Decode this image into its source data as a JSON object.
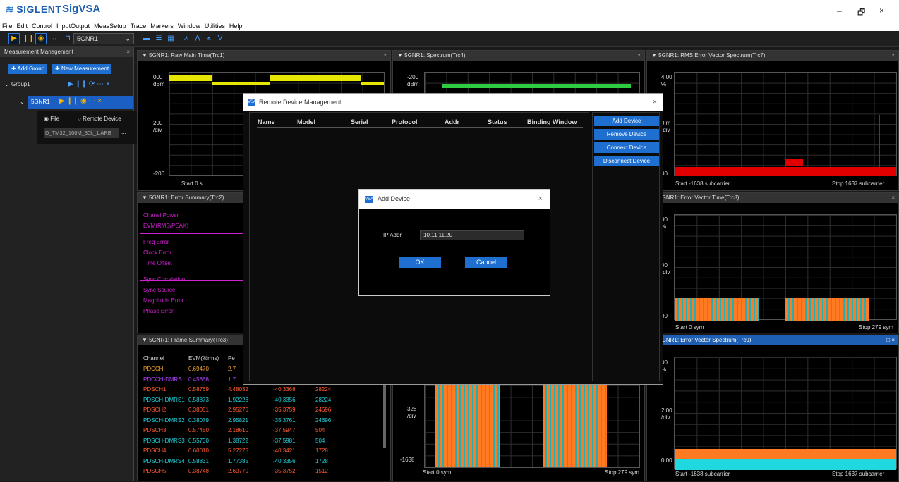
{
  "titlebar": {
    "brand": "SIGLENT",
    "app": "SigVSA",
    "min": "–",
    "max": "🗗",
    "close": "×"
  },
  "menu": [
    "File",
    "Edit",
    "Control",
    "InputOutput",
    "MeasSetup",
    "Trace",
    "Markers",
    "Window",
    "Utilities",
    "Help"
  ],
  "toolbar": {
    "meas_select": "5GNR1"
  },
  "mm": {
    "title": "Measurement Management",
    "add_group": "Add Group",
    "new_meas": "New Measurement",
    "group": "Group1",
    "meas": "5GNR1",
    "file_label": "File",
    "remote_label": "Remote Device",
    "file_path": "D_TM32_100M_30k_1.ARB",
    "dots": "..."
  },
  "panels": {
    "raw": {
      "title": "5GNR1: Raw Main Time(Trc1)",
      "top": "000",
      "unit": "dBm",
      "div": "200",
      "div_unit": "/div",
      "bottom": "-200",
      "start": "Start 0 s"
    },
    "spec": {
      "title": "5GNR1: Spectrum(Trc4)",
      "top": "-200",
      "unit": "dBm"
    },
    "rms": {
      "title": "5GNR1: RMS Error Vector Spectrum(Trc7)",
      "top": "4.00",
      "unit": "%",
      "mid": "0 m",
      "div": "/div",
      "bottom": "00",
      "start": "Start -1638 subcarrier",
      "stop": "Stop 1637 subcarrier"
    },
    "err": {
      "title": "5GNR1: Error Summary(Trc2)",
      "rows": [
        "Chanel Power",
        "EVM(RMS/PEAK)",
        "Freq Error",
        "Clock Error",
        "Time Offset",
        "Sync Correlation",
        "Sync Source",
        "Magnitude Error",
        "Phase Error"
      ]
    },
    "evt": {
      "title": "5GNR1: Error Vector Time(Trc8)",
      "top": "00",
      "unit": "%",
      "mid": "00",
      "div": "/div",
      "bottom": "00",
      "start": "Start 0 sym",
      "stop": "Stop 279 sym"
    },
    "frame": {
      "title": "5GNR1: Frame Summary(Trc3)",
      "h_channel": "Channel",
      "h_evm": "EVM(%rms)",
      "h_pe": "Pe",
      "rows": [
        {
          "ch": "PDCCH",
          "evm": "0.69470",
          "pe": "2.7",
          "c4": "",
          "c5": "",
          "color": "#f0a030"
        },
        {
          "ch": "PDCCH-DMRS",
          "evm": "0.45868",
          "pe": "1.7",
          "c4": "",
          "c5": "",
          "color": "#b040ff"
        },
        {
          "ch": "PDSCH1",
          "evm": "0.58769",
          "pe": "4.48032",
          "c4": "-40.3368",
          "c5": "28224",
          "color": "#ff5a30"
        },
        {
          "ch": "PDSCH-DMRS1",
          "evm": "0.58873",
          "pe": "1.92226",
          "c4": "-40.3356",
          "c5": "28224",
          "color": "#20d0d8"
        },
        {
          "ch": "PDSCH2",
          "evm": "0.38051",
          "pe": "2.95270",
          "c4": "-35.3759",
          "c5": "24696",
          "color": "#ff5a30"
        },
        {
          "ch": "PDSCH-DMRS2",
          "evm": "0.38079",
          "pe": "2.95821",
          "c4": "-35.3761",
          "c5": "24696",
          "color": "#20d0d8"
        },
        {
          "ch": "PDSCH3",
          "evm": "0.57450",
          "pe": "2.18610",
          "c4": "-37.5947",
          "c5": "504",
          "color": "#ff5a30"
        },
        {
          "ch": "PDSCH-DMRS3",
          "evm": "0.55730",
          "pe": "1.38722",
          "c4": "-37.5981",
          "c5": "504",
          "color": "#20d0d8"
        },
        {
          "ch": "PDSCH4",
          "evm": "0.60010",
          "pe": "5.27275",
          "c4": "-40.3421",
          "c5": "1728",
          "color": "#ff5a30"
        },
        {
          "ch": "PDSCH-DMRS4",
          "evm": "0.58831",
          "pe": "1.77385",
          "c4": "-40.3356",
          "c5": "1728",
          "color": "#20d0d8"
        },
        {
          "ch": "PDSCH5",
          "evm": "0.38748",
          "pe": "2.69770",
          "c4": "-35.3752",
          "c5": "1512",
          "color": "#ff5a30"
        }
      ]
    },
    "const": {
      "mid": "328",
      "div": "/div",
      "bottom": "-1638",
      "start": "Start 0 sym",
      "stop": "Stop 279 sym"
    },
    "evs": {
      "title": "5GNR1: Error Vector Spectrum(Trc9)",
      "top": "00",
      "unit": "%",
      "mid": "2.00",
      "div": "/div",
      "bottom": "0.00",
      "start": "Start -1638 subcarrier",
      "stop": "Stop 1637 subcarrier"
    }
  },
  "rdm": {
    "title": "Remote Device Management",
    "cols": [
      "Name",
      "Model",
      "Serial",
      "Protocol",
      "Addr",
      "Status",
      "Binding Window"
    ],
    "buttons": [
      "Add Device",
      "Remove Device",
      "Connect Device",
      "Disconnect Device"
    ]
  },
  "add_device": {
    "title": "Add Device",
    "ip_label": "IP Addr",
    "ip_value": "10.11.11.20",
    "ok": "OK",
    "cancel": "Cancel"
  },
  "colors": {
    "accent": "#1f6fd1",
    "yellow_trace": "#e6e600",
    "green_trace": "#2ecc40",
    "red_trace": "#e00000",
    "orange_trace": "#ff7a20",
    "cyan_trace": "#20d8e0"
  }
}
